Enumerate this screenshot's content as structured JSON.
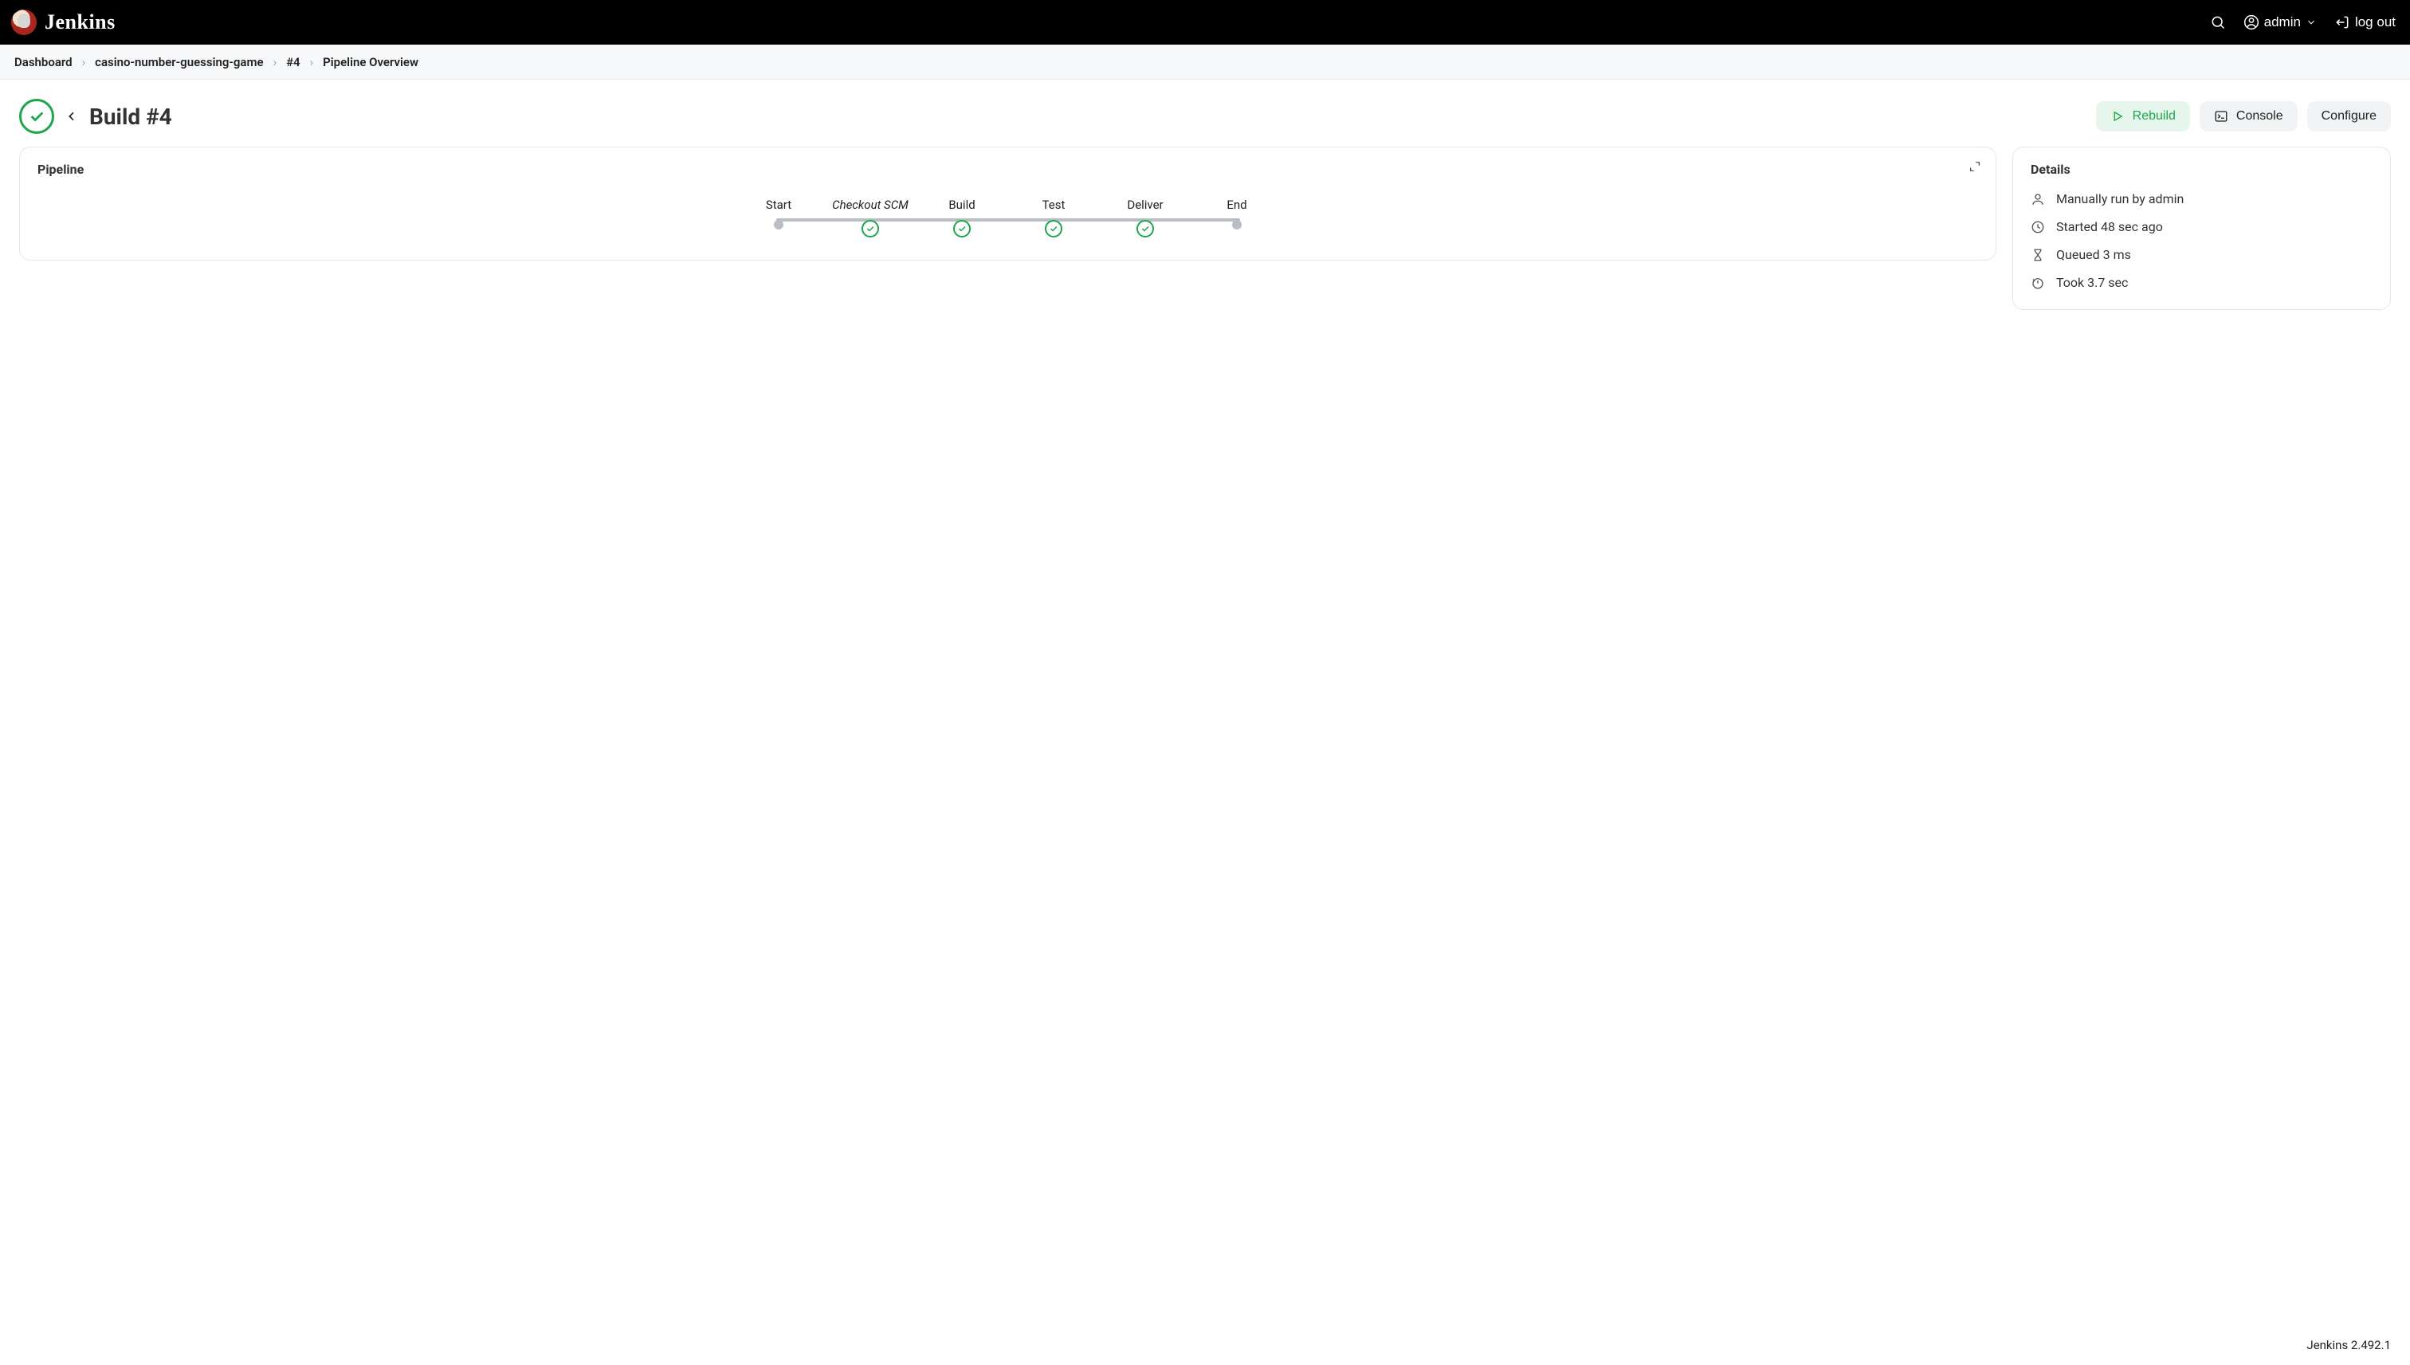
{
  "brand": {
    "name": "Jenkins"
  },
  "header": {
    "user": "admin",
    "logout": "log out"
  },
  "breadcrumbs": [
    "Dashboard",
    "casino-number-guessing-game",
    "#4",
    "Pipeline Overview"
  ],
  "page": {
    "title": "Build #4",
    "actions": {
      "rebuild": "Rebuild",
      "console": "Console",
      "configure": "Configure"
    }
  },
  "pipeline": {
    "heading": "Pipeline",
    "stages": [
      {
        "label": "Start",
        "kind": "dot"
      },
      {
        "label": "Checkout SCM",
        "kind": "check",
        "italic": true
      },
      {
        "label": "Build",
        "kind": "check"
      },
      {
        "label": "Test",
        "kind": "check"
      },
      {
        "label": "Deliver",
        "kind": "check"
      },
      {
        "label": "End",
        "kind": "dot"
      }
    ]
  },
  "details": {
    "heading": "Details",
    "run_by": "Manually run by admin",
    "started": "Started 48 sec ago",
    "queued": "Queued 3 ms",
    "took": "Took 3.7 sec"
  },
  "footer": {
    "version": "Jenkins 2.492.1"
  }
}
